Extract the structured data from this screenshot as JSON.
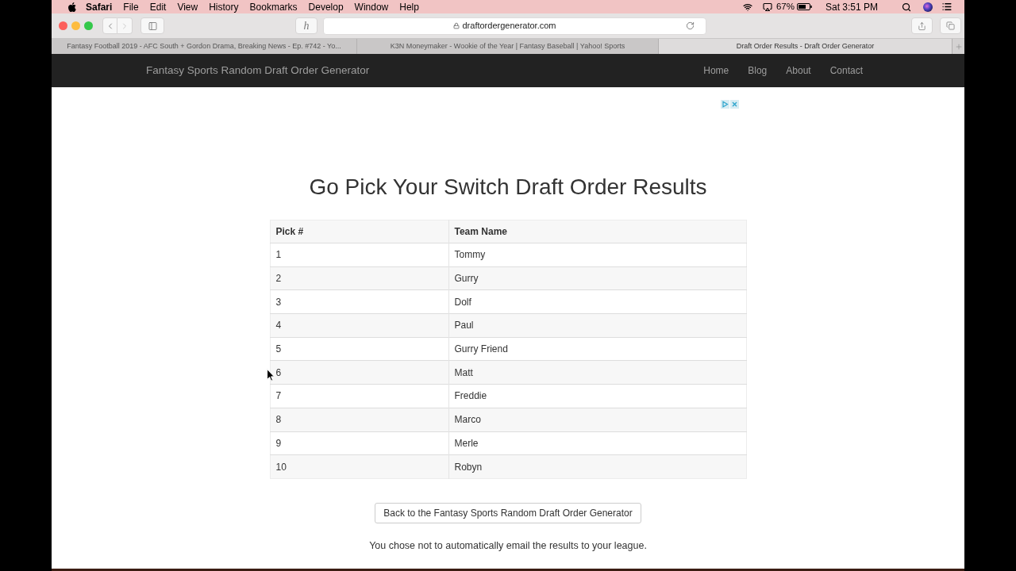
{
  "menu_bar": {
    "app": "Safari",
    "menus": [
      "File",
      "Edit",
      "View",
      "History",
      "Bookmarks",
      "Develop",
      "Window",
      "Help"
    ],
    "battery": "67%",
    "clock": "Sat 3:51 PM"
  },
  "toolbar": {
    "extension_label": "h",
    "address": "draftordergenerator.com"
  },
  "tabs": [
    {
      "label": "Fantasy Football 2019 - AFC South + Gordon Drama, Breaking News - Ep. #742 - Yo...",
      "selected": false
    },
    {
      "label": "K3N Moneymaker - Wookie of the Year | Fantasy Baseball | Yahoo! Sports",
      "selected": false
    },
    {
      "label": "Draft Order Results - Draft Order Generator",
      "selected": true
    }
  ],
  "navbar": {
    "brand": "Fantasy Sports Random Draft Order Generator",
    "links": [
      "Home",
      "Blog",
      "About",
      "Contact"
    ]
  },
  "page": {
    "title": "Go Pick Your Switch Draft Order Results",
    "table": {
      "columns": [
        "Pick #",
        "Team Name"
      ],
      "rows": [
        [
          "1",
          "Tommy"
        ],
        [
          "2",
          "Gurry"
        ],
        [
          "3",
          "Dolf"
        ],
        [
          "4",
          "Paul"
        ],
        [
          "5",
          "Gurry Friend"
        ],
        [
          "6",
          "Matt"
        ],
        [
          "7",
          "Freddie"
        ],
        [
          "8",
          "Marco"
        ],
        [
          "9",
          "Merle"
        ],
        [
          "10",
          "Robyn"
        ]
      ]
    },
    "back_button": "Back to the Fantasy Sports Random Draft Order Generator",
    "note": "You chose not to automatically email the results to your league."
  }
}
